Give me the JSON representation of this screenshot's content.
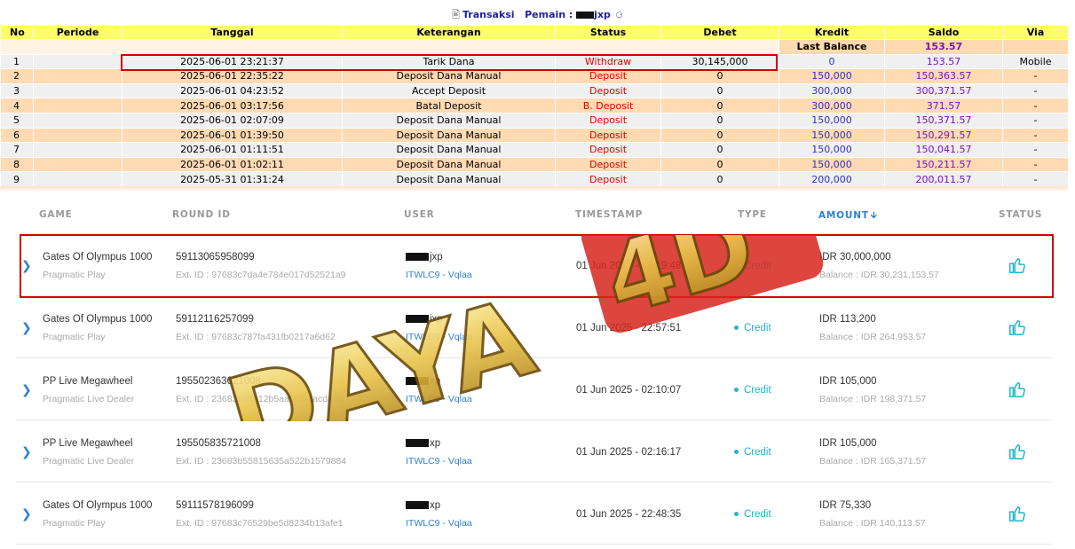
{
  "header": {
    "title_prefix": "Transaksi",
    "player_label": "Pemain :",
    "player_name_visible": "jxp"
  },
  "transactions": {
    "columns": [
      "No",
      "Periode",
      "Tanggal",
      "Keterangan",
      "Status",
      "Debet",
      "Kredit",
      "Saldo",
      "Via"
    ],
    "last_balance_label": "Last Balance",
    "last_balance_value": "153.57",
    "rows": [
      {
        "no": "1",
        "periode": "",
        "tanggal": "2025-06-01 23:21:37",
        "keterangan": "Tarik Dana",
        "status": "Withdraw",
        "debet": "30,145,000",
        "kredit": "0",
        "saldo": "153.57",
        "via": "Mobile"
      },
      {
        "no": "2",
        "periode": "",
        "tanggal": "2025-06-01 22:35:22",
        "keterangan": "Deposit Dana Manual",
        "status": "Deposit",
        "debet": "0",
        "kredit": "150,000",
        "saldo": "150,363.57",
        "via": "-"
      },
      {
        "no": "3",
        "periode": "",
        "tanggal": "2025-06-01 04:23:52",
        "keterangan": "Accept Deposit",
        "status": "Deposit",
        "debet": "0",
        "kredit": "300,000",
        "saldo": "300,371.57",
        "via": "-"
      },
      {
        "no": "4",
        "periode": "",
        "tanggal": "2025-06-01 03:17:56",
        "keterangan": "Batal Deposit",
        "status": "B. Deposit",
        "debet": "0",
        "kredit": "300,000",
        "saldo": "371.57",
        "via": "-"
      },
      {
        "no": "5",
        "periode": "",
        "tanggal": "2025-06-01 02:07:09",
        "keterangan": "Deposit Dana Manual",
        "status": "Deposit",
        "debet": "0",
        "kredit": "150,000",
        "saldo": "150,371.57",
        "via": "-"
      },
      {
        "no": "6",
        "periode": "",
        "tanggal": "2025-06-01 01:39:50",
        "keterangan": "Deposit Dana Manual",
        "status": "Deposit",
        "debet": "0",
        "kredit": "150,000",
        "saldo": "150,291.57",
        "via": "-"
      },
      {
        "no": "7",
        "periode": "",
        "tanggal": "2025-06-01 01:11:51",
        "keterangan": "Deposit Dana Manual",
        "status": "Deposit",
        "debet": "0",
        "kredit": "150,000",
        "saldo": "150,041.57",
        "via": "-"
      },
      {
        "no": "8",
        "periode": "",
        "tanggal": "2025-06-01 01:02:11",
        "keterangan": "Deposit Dana Manual",
        "status": "Deposit",
        "debet": "0",
        "kredit": "150,000",
        "saldo": "150,211.57",
        "via": "-"
      },
      {
        "no": "9",
        "periode": "",
        "tanggal": "2025-05-31 01:31:24",
        "keterangan": "Deposit Dana Manual",
        "status": "Deposit",
        "debet": "0",
        "kredit": "200,000",
        "saldo": "200,011.57",
        "via": "-"
      }
    ]
  },
  "game_history": {
    "columns": {
      "game": "GAME",
      "round_id": "ROUND ID",
      "user": "USER",
      "timestamp": "TIMESTAMP",
      "type": "TYPE",
      "amount": "AMOUNT",
      "status": "STATUS"
    },
    "rows": [
      {
        "game": "Gates Of Olympus 1000",
        "provider": "Pragmatic Play",
        "round_id": "59113065958099",
        "ext_id": "Ext. ID : 97683c7da4e784e017d52521a9",
        "user": "jxp",
        "agent": "ITWLC9 - Vqlaa",
        "timestamp": "01 Jun 2025 - 23:19:48",
        "type": "Credit",
        "amount": "IDR 30,000,000",
        "balance": "Balance : IDR 30,231,153.57"
      },
      {
        "game": "Gates Of Olympus 1000",
        "provider": "Pragmatic Play",
        "round_id": "59112116257099",
        "ext_id": "Ext. ID : 97683c787fa431fb0217a6d62",
        "user": "jxp",
        "agent": "ITWLC9 - Vqlaa",
        "timestamp": "01 Jun 2025 - 22:57:51",
        "type": "Credit",
        "amount": "IDR 113,200",
        "balance": "Balance : IDR 264,953.57"
      },
      {
        "game": "PP Live Megawheel",
        "provider": "Pragmatic Live Dealer",
        "round_id": "195502363621008",
        "ext_id": "Ext. ID : 23683b54012b5aaf7593acda30",
        "user": "xp",
        "agent": "ITWLC9 - Vqlaa",
        "timestamp": "01 Jun 2025 - 02:10:07",
        "type": "Credit",
        "amount": "IDR 105,000",
        "balance": "Balance : IDR 198,371.57"
      },
      {
        "game": "PP Live Megawheel",
        "provider": "Pragmatic Live Dealer",
        "round_id": "195505835721008",
        "ext_id": "Ext. ID : 23683b55815635a522b1579884",
        "user": "xp",
        "agent": "ITWLC9 - Vqlaa",
        "timestamp": "01 Jun 2025 - 02:16:17",
        "type": "Credit",
        "amount": "IDR 105,000",
        "balance": "Balance : IDR 165,371.57"
      },
      {
        "game": "Gates Of Olympus 1000",
        "provider": "Pragmatic Play",
        "round_id": "59111578196099",
        "ext_id": "Ext. ID : 97683c76529be5d8234b13afe1",
        "user": "xp",
        "agent": "ITWLC9 - Vqlaa",
        "timestamp": "01 Jun 2025 - 22:48:35",
        "type": "Credit",
        "amount": "IDR 75,330",
        "balance": "Balance : IDR 140,113.57"
      }
    ]
  },
  "watermark": {
    "text": "DAYA 4D",
    "word": "DAYA",
    "num": "4D"
  },
  "colors": {
    "header_yellow": "#ffff66",
    "row_peach": "#ffdab2",
    "row_gray": "#f0f0f0",
    "status_red": "#e00000",
    "kredit_blue": "#3030c0",
    "saldo_purple": "#7a10c0",
    "accent_blue": "#2f7fd8",
    "credit_teal": "#20b5c8",
    "highlight_red": "#d40000"
  },
  "icons": [
    "document-icon",
    "info-icon",
    "chevron-right-icon",
    "thumbs-up-icon",
    "sort-down-icon",
    "dot-icon"
  ]
}
